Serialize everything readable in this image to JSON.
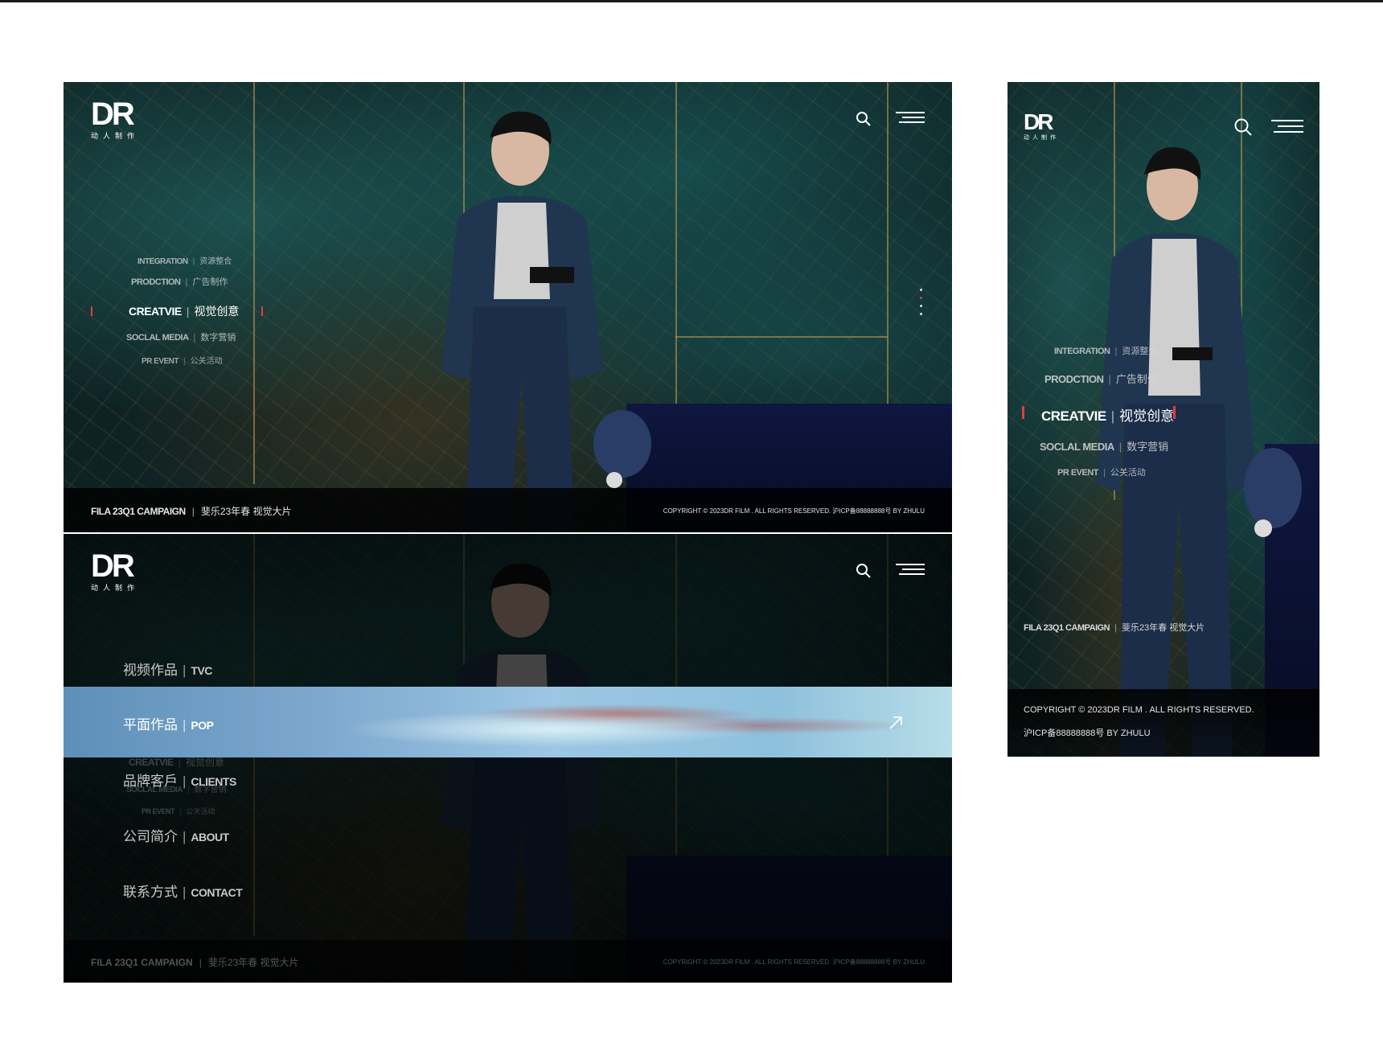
{
  "logo": {
    "mark": "DR",
    "sub": "动人制作"
  },
  "desktop_nav": [
    {
      "en": "INTEGRATION",
      "cn": "资源整合",
      "active": false
    },
    {
      "en": "PRODCTION",
      "cn": "广告制作",
      "active": false
    },
    {
      "en": "CREATVIE",
      "cn": "视觉创意",
      "active": true
    },
    {
      "en": "SOCLAL MEDIA",
      "cn": "数字营销",
      "active": false
    },
    {
      "en": "PR EVENT",
      "cn": "公关活动",
      "active": false
    }
  ],
  "footer": {
    "campaign_en": "FILA 23Q1 CAMPAIGN",
    "campaign_cn": "斐乐23年春 视觉大片",
    "copyright": "COPYRIGHT © 2023DR FILM . ALL RIGHTS RESERVED.",
    "icp": "沪ICP备88888888号",
    "by": "BY ZHULU",
    "copyright_full": "COPYRIGHT © 2023DR FILM . ALL RIGHTS RESERVED. 沪ICP备88888888号 BY ZHULU"
  },
  "menu": [
    {
      "cn": "视频作品",
      "en": "TVC",
      "active": false
    },
    {
      "cn": "平面作品",
      "en": "POP",
      "active": true
    },
    {
      "cn": "品牌客戶",
      "en": "CLIENTS",
      "active": false
    },
    {
      "cn": "公司简介",
      "en": "ABOUT",
      "active": false
    },
    {
      "cn": "联系方式",
      "en": "CONTACT",
      "active": false
    }
  ],
  "mobile_copyright_line1": "COPYRIGHT © 2023DR FILM . ALL RIGHTS RESERVED.",
  "mobile_copyright_line2": "沪ICP备88888888号 BY ZHULU",
  "colors": {
    "accent": "#e0403a",
    "bg_dark": "#0e2224"
  },
  "icons": [
    "search-icon",
    "hamburger-menu-icon",
    "arrow-up-right-icon"
  ]
}
